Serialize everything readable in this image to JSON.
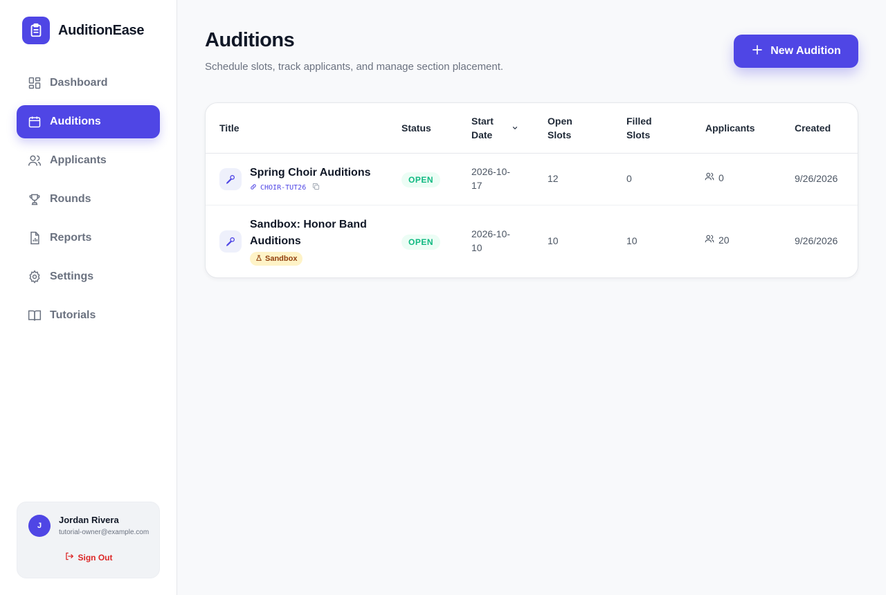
{
  "app": {
    "name": "AuditionEase"
  },
  "nav": {
    "items": [
      {
        "label": "Dashboard",
        "icon": "dashboard-icon",
        "active": false
      },
      {
        "label": "Auditions",
        "icon": "calendar-icon",
        "active": true
      },
      {
        "label": "Applicants",
        "icon": "users-icon",
        "active": false
      },
      {
        "label": "Rounds",
        "icon": "trophy-icon",
        "active": false
      },
      {
        "label": "Reports",
        "icon": "report-icon",
        "active": false
      },
      {
        "label": "Settings",
        "icon": "gear-icon",
        "active": false
      },
      {
        "label": "Tutorials",
        "icon": "book-icon",
        "active": false
      }
    ]
  },
  "user": {
    "initial": "J",
    "name": "Jordan Rivera",
    "email": "tutorial-owner@example.com",
    "signout_label": "Sign Out"
  },
  "page": {
    "title": "Auditions",
    "subtitle": "Schedule slots, track applicants, and manage section placement.",
    "new_button_label": "New Audition"
  },
  "table": {
    "columns": {
      "title": "Title",
      "status": "Status",
      "start_date_line1": "Start",
      "start_date_line2": "Date",
      "open_slots_line1": "Open",
      "open_slots_line2": "Slots",
      "filled_slots_line1": "Filled",
      "filled_slots_line2": "Slots",
      "applicants": "Applicants",
      "created": "Created"
    },
    "rows": [
      {
        "title": "Spring Choir Auditions",
        "code": "CHOIR-TUT26",
        "status": "OPEN",
        "start_date_line1": "2026-10-",
        "start_date_line2": "17",
        "open_slots": "12",
        "filled_slots": "0",
        "applicants": "0",
        "created": "9/26/2026"
      },
      {
        "title_line1": "Sandbox: Honor Band",
        "title_line2": "Auditions",
        "badge": "Sandbox",
        "status": "OPEN",
        "start_date_line1": "2026-10-",
        "start_date_line2": "10",
        "open_slots": "10",
        "filled_slots": "10",
        "applicants": "20",
        "created": "9/26/2026"
      }
    ]
  },
  "colors": {
    "accent": "#4f46e5",
    "status_open_text": "#10b981",
    "status_open_bg": "#ecfdf5",
    "sandbox_bg": "#fef3c7",
    "signout": "#dc2626"
  }
}
